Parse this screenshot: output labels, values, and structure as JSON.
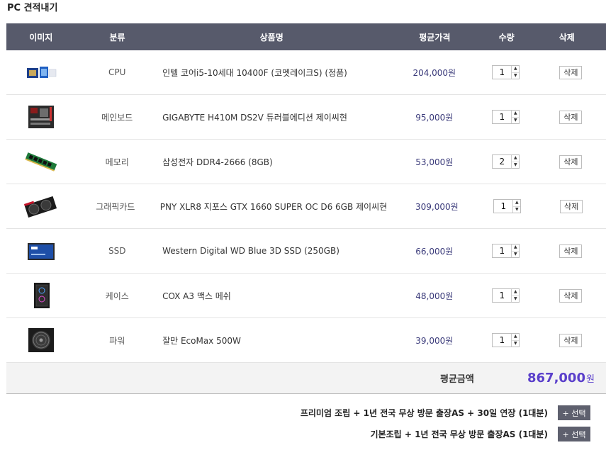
{
  "page_title": "PC 견적내기",
  "headers": {
    "image": "이미지",
    "category": "분류",
    "name": "상품명",
    "price": "평균가격",
    "qty": "수량",
    "delete": "삭제"
  },
  "items": [
    {
      "category": "CPU",
      "name": "인텔 코어i5-10세대 10400F (코멧레이크S) (정품)",
      "price": "204,000원",
      "qty": "1",
      "delete": "삭제",
      "icon": "cpu-icon"
    },
    {
      "category": "메인보드",
      "name": "GIGABYTE H410M DS2V 듀러블에디션 제이씨현",
      "price": "95,000원",
      "qty": "1",
      "delete": "삭제",
      "icon": "motherboard-icon"
    },
    {
      "category": "메모리",
      "name": "삼성전자 DDR4-2666 (8GB)",
      "price": "53,000원",
      "qty": "2",
      "delete": "삭제",
      "icon": "ram-icon"
    },
    {
      "category": "그래픽카드",
      "name": "PNY XLR8 지포스 GTX 1660 SUPER OC D6 6GB 제이씨현",
      "price": "309,000원",
      "qty": "1",
      "delete": "삭제",
      "icon": "gpu-icon"
    },
    {
      "category": "SSD",
      "name": "Western Digital WD Blue 3D SSD (250GB)",
      "price": "66,000원",
      "qty": "1",
      "delete": "삭제",
      "icon": "ssd-icon"
    },
    {
      "category": "케이스",
      "name": "COX A3 맥스 메쉬",
      "price": "48,000원",
      "qty": "1",
      "delete": "삭제",
      "icon": "case-icon"
    },
    {
      "category": "파워",
      "name": "잘만 EcoMax 500W",
      "price": "39,000원",
      "qty": "1",
      "delete": "삭제",
      "icon": "psu-icon"
    }
  ],
  "total": {
    "label": "평균금액",
    "amount": "867,000",
    "unit": "원"
  },
  "options": [
    {
      "text": "프리미엄 조립 + 1년 전국 무상 방문 출장AS + 30일 연장 (1대분)",
      "button": "+ 선택"
    },
    {
      "text": "기본조립 + 1년 전국 무상 방문 출장AS (1대분)",
      "button": "+ 선택"
    }
  ],
  "colors": {
    "header_bg": "#575a6b",
    "accent": "#5a3fcb",
    "price_text": "#3a3a7a"
  }
}
